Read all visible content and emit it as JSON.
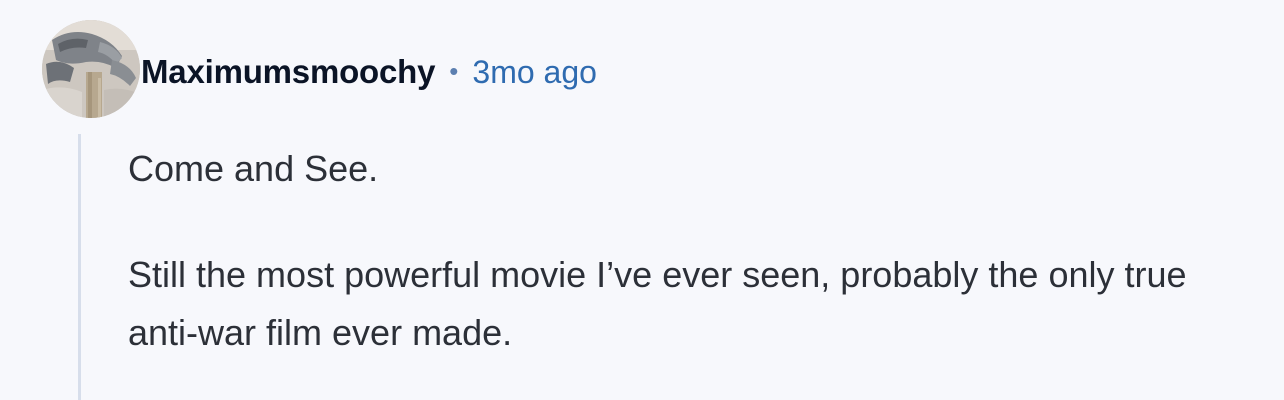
{
  "comment": {
    "author": "Maximumsmoochy",
    "separator": "•",
    "timestamp": "3mo ago",
    "paragraphs": [
      "Come and See.",
      "Still the most powerful movie I’ve ever seen, probably the only true anti-war film ever made."
    ],
    "avatar_icon": "cat-photo-avatar"
  },
  "colors": {
    "background": "#f7f8fc",
    "author": "#0b1426",
    "timestamp": "#2f6bb0",
    "body_text": "#2c3038",
    "thread_line": "#d7deeb"
  }
}
